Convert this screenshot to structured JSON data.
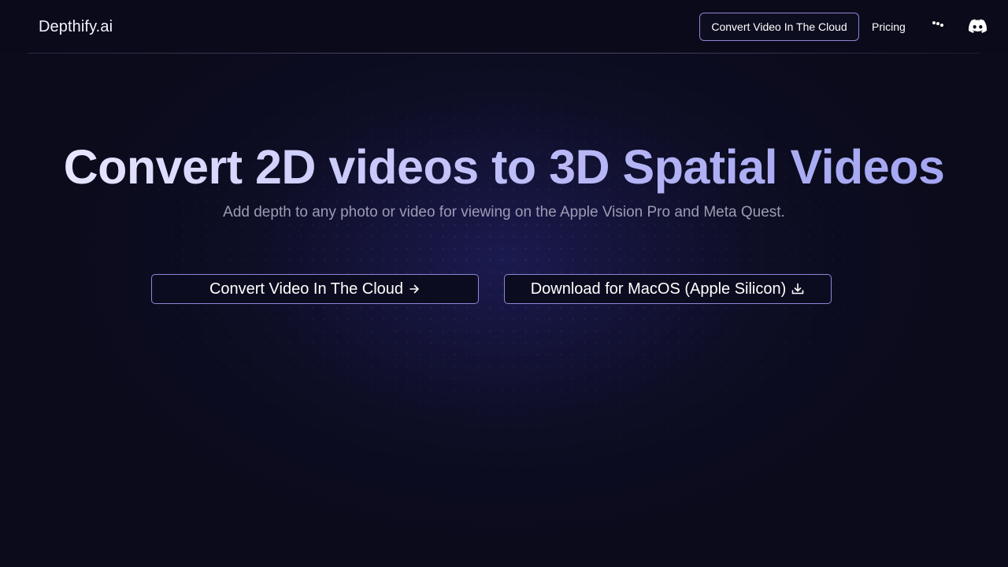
{
  "header": {
    "logo": "Depthify.ai",
    "cta_label": "Convert Video In The Cloud",
    "pricing_label": "Pricing",
    "more_icon": "ellipsis-icon",
    "discord_icon": "discord-icon"
  },
  "hero": {
    "title": "Convert 2D videos to 3D Spatial Videos",
    "subtitle": "Add depth to any photo or video for viewing on the Apple Vision Pro and Meta Quest.",
    "primary_button": {
      "label": "Convert Video In The Cloud",
      "icon": "arrow-right-icon"
    },
    "secondary_button": {
      "label": "Download for MacOS (Apple Silicon)",
      "icon": "download-icon"
    }
  },
  "colors": {
    "background": "#0b0b1c",
    "accent_border": "#8c87d9",
    "title_gradient_start": "#e6e6ff",
    "title_gradient_end": "#a3a6f2",
    "subtitle": "#9c9cb4"
  }
}
